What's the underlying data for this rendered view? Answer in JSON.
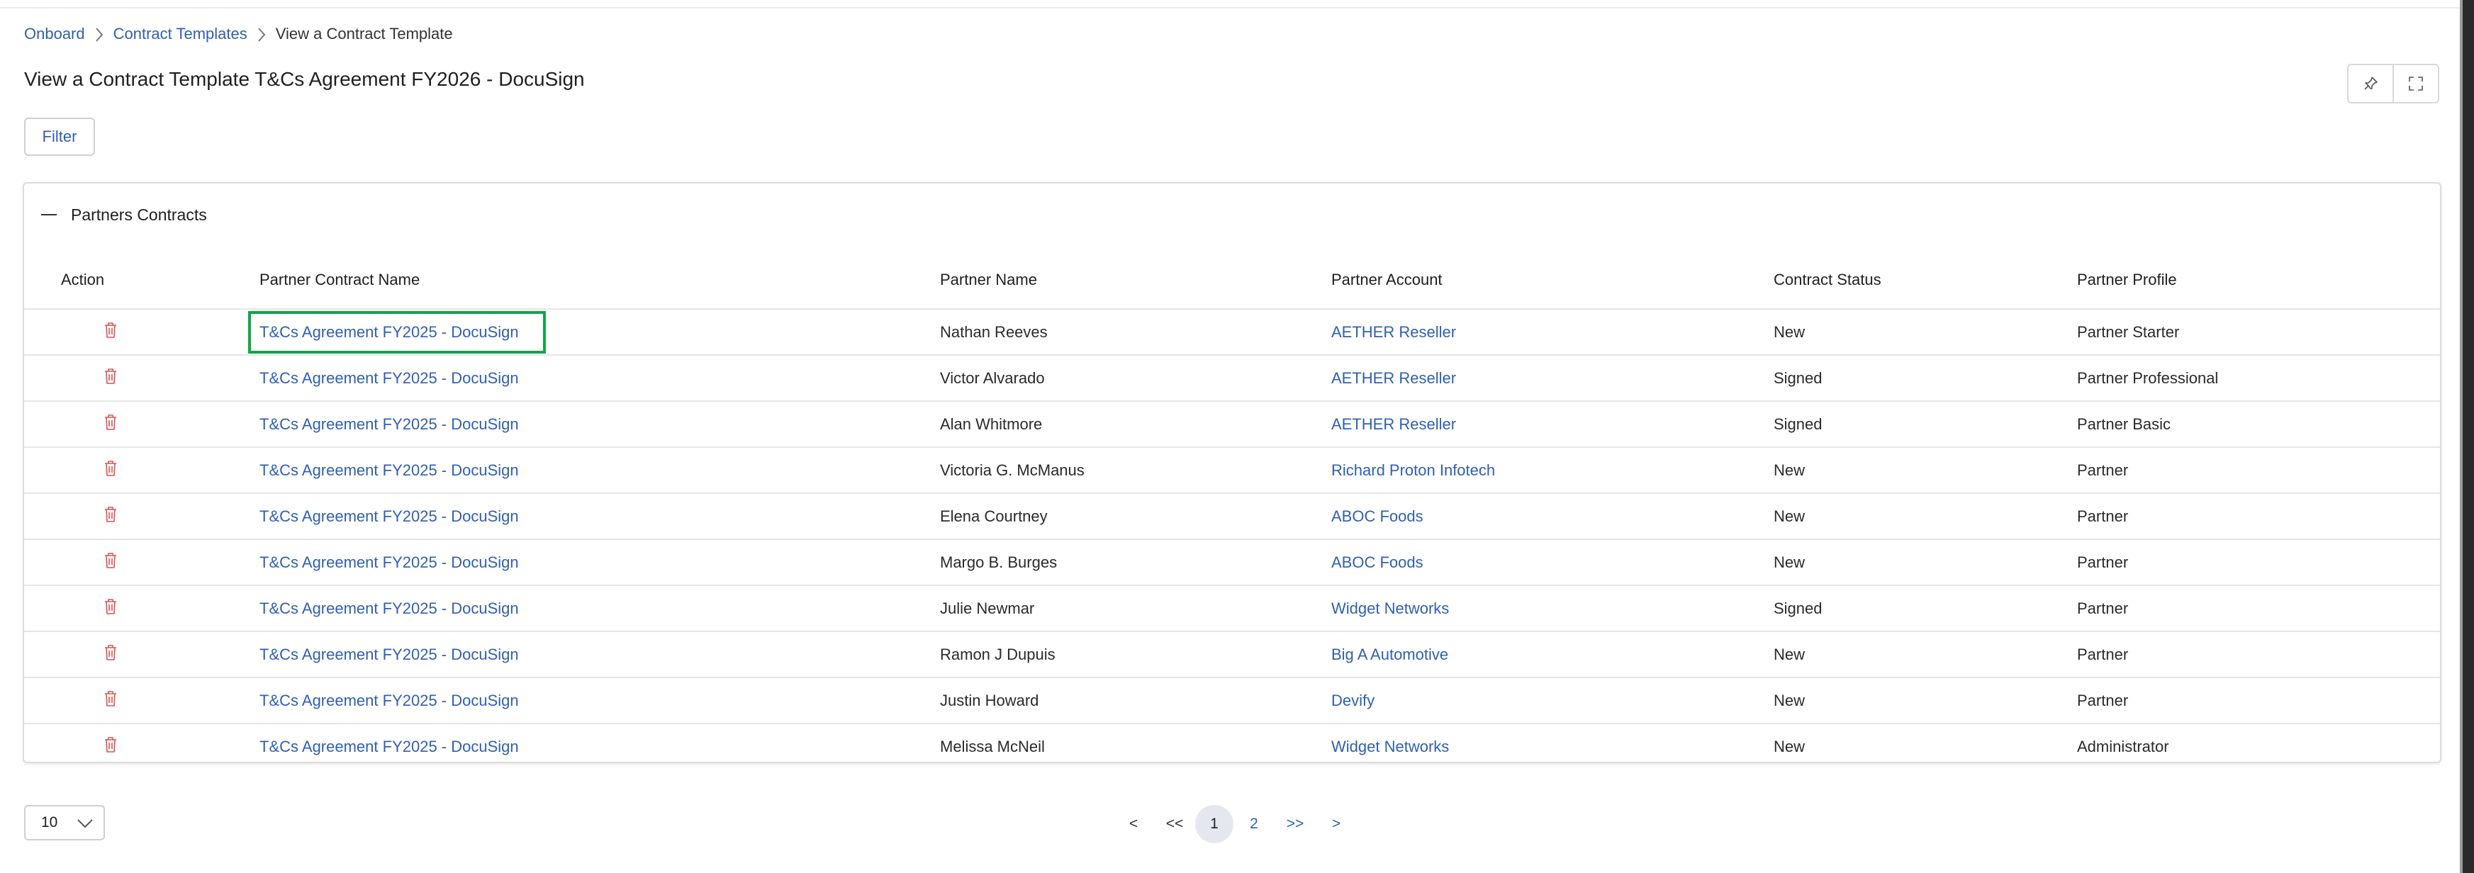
{
  "breadcrumb": {
    "items": [
      "Onboard",
      "Contract Templates"
    ],
    "current": "View a Contract Template"
  },
  "page": {
    "title": "View a Contract Template T&Cs Agreement FY2026 - DocuSign",
    "filter_label": "Filter"
  },
  "section": {
    "title": "Partners Contracts"
  },
  "table": {
    "headers": {
      "action": "Action",
      "contract_name": "Partner Contract Name",
      "partner_name": "Partner Name",
      "partner_account": "Partner Account",
      "contract_status": "Contract Status",
      "partner_profile": "Partner Profile"
    },
    "rows": [
      {
        "contract_name": "T&Cs Agreement FY2025 - DocuSign",
        "partner_name": "Nathan Reeves",
        "partner_account": "AETHER Reseller",
        "contract_status": "New",
        "partner_profile": "Partner Starter"
      },
      {
        "contract_name": "T&Cs Agreement FY2025 - DocuSign",
        "partner_name": "Victor Alvarado",
        "partner_account": "AETHER Reseller",
        "contract_status": "Signed",
        "partner_profile": "Partner Professional"
      },
      {
        "contract_name": "T&Cs Agreement FY2025 - DocuSign",
        "partner_name": "Alan Whitmore",
        "partner_account": "AETHER Reseller",
        "contract_status": "Signed",
        "partner_profile": "Partner Basic"
      },
      {
        "contract_name": "T&Cs Agreement FY2025 - DocuSign",
        "partner_name": "Victoria G. McManus",
        "partner_account": "Richard Proton Infotech",
        "contract_status": "New",
        "partner_profile": "Partner"
      },
      {
        "contract_name": "T&Cs Agreement FY2025 - DocuSign",
        "partner_name": "Elena Courtney",
        "partner_account": "ABOC Foods",
        "contract_status": "New",
        "partner_profile": "Partner"
      },
      {
        "contract_name": "T&Cs Agreement FY2025 - DocuSign",
        "partner_name": "Margo B. Burges",
        "partner_account": "ABOC Foods",
        "contract_status": "New",
        "partner_profile": "Partner"
      },
      {
        "contract_name": "T&Cs Agreement FY2025 - DocuSign",
        "partner_name": "Julie Newmar",
        "partner_account": "Widget Networks",
        "contract_status": "Signed",
        "partner_profile": "Partner"
      },
      {
        "contract_name": "T&Cs Agreement FY2025 - DocuSign",
        "partner_name": "Ramon J Dupuis",
        "partner_account": "Big A Automotive",
        "contract_status": "New",
        "partner_profile": "Partner"
      },
      {
        "contract_name": "T&Cs Agreement FY2025 - DocuSign",
        "partner_name": "Justin Howard",
        "partner_account": "Devify",
        "contract_status": "New",
        "partner_profile": "Partner"
      },
      {
        "contract_name": "T&Cs Agreement FY2025 - DocuSign",
        "partner_name": "Melissa McNeil",
        "partner_account": "Widget Networks",
        "contract_status": "New",
        "partner_profile": "Administrator"
      }
    ]
  },
  "pagination": {
    "page_size": "10",
    "prev": "<",
    "first": "<<",
    "pages": [
      "1",
      "2"
    ],
    "current": "1",
    "last": ">>",
    "next": ">"
  },
  "colors": {
    "link": "#2f5fb3",
    "highlight": "#17a34a",
    "trash": "#d9534f"
  }
}
